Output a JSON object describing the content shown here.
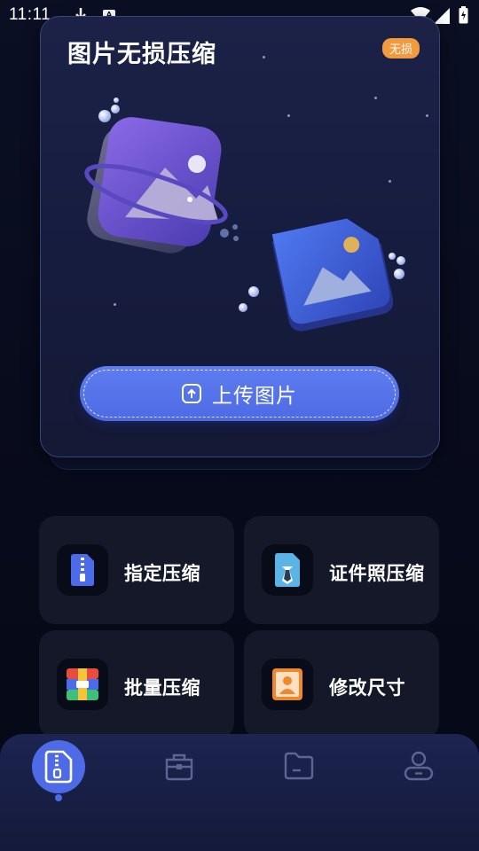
{
  "status_bar": {
    "time": "11:11",
    "icons": [
      "download-icon",
      "a-text-icon",
      "wifi-icon",
      "signal-icon",
      "battery-icon"
    ]
  },
  "hero": {
    "title": "图片无损压缩",
    "badge": "无损",
    "upload_label": "上传图片"
  },
  "tools": [
    {
      "label": "指定压缩",
      "icon": "zip-file-icon",
      "color": "#4b6be8"
    },
    {
      "label": "证件照压缩",
      "icon": "id-photo-icon",
      "color": "#5ab4e6"
    },
    {
      "label": "批量压缩",
      "icon": "archive-icon",
      "color": "#e94b3c"
    },
    {
      "label": "修改尺寸",
      "icon": "resize-icon",
      "color": "#f0872c"
    }
  ],
  "bottom_nav": {
    "items": [
      {
        "name": "compress",
        "icon": "compress-tab-icon",
        "active": true
      },
      {
        "name": "toolbox",
        "icon": "toolbox-icon",
        "active": false
      },
      {
        "name": "files",
        "icon": "folder-icon",
        "active": false
      },
      {
        "name": "profile",
        "icon": "user-icon",
        "active": false
      }
    ]
  },
  "colors": {
    "accent": "#4f6ae6",
    "badge": "#f19a3e",
    "background": "#070a1a"
  }
}
